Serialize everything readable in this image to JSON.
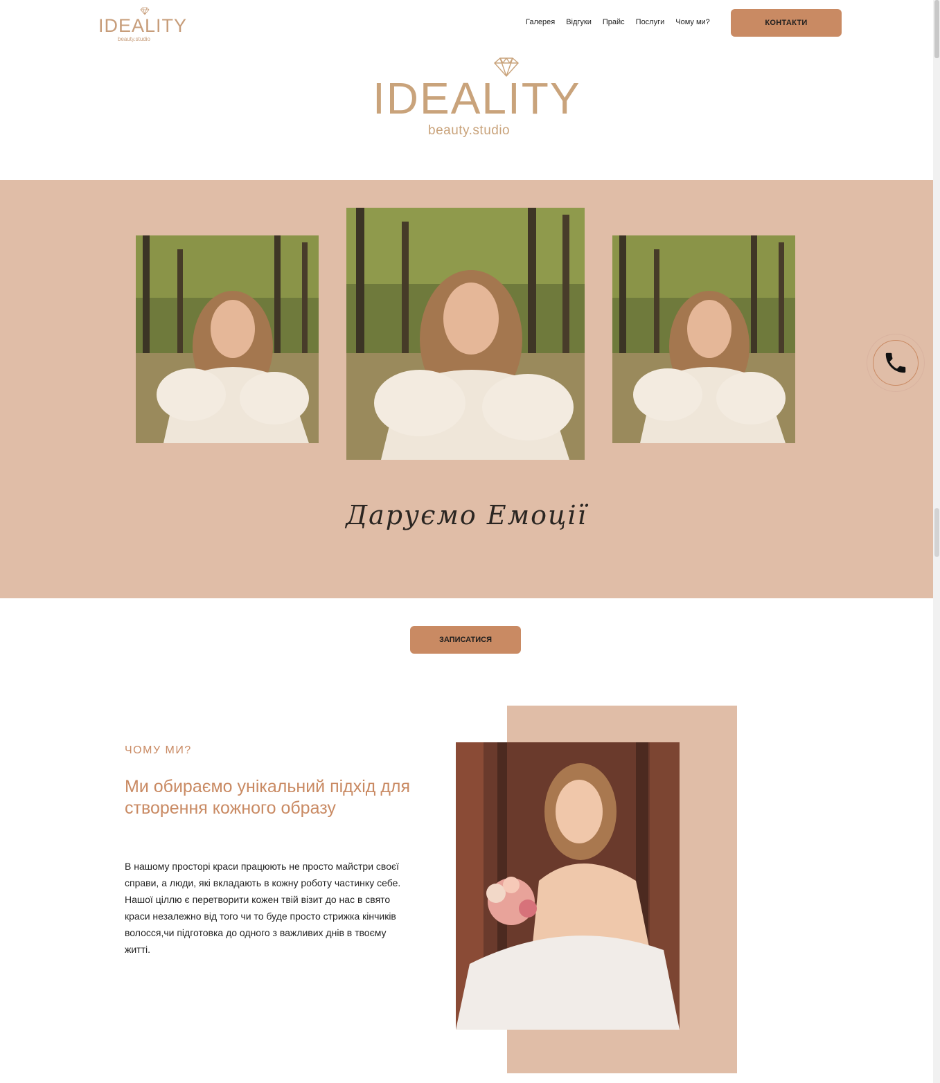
{
  "brand": {
    "name": "IDEALITY",
    "subtitle": "beauty.studio",
    "accent": "#c98a63",
    "band_color": "#e0bda7",
    "logo_gold": "#c9a37b"
  },
  "nav": {
    "items": [
      {
        "label": "Галерея"
      },
      {
        "label": "Відгуки"
      },
      {
        "label": "Прайс"
      },
      {
        "label": "Послуги"
      },
      {
        "label": "Чому ми?"
      }
    ],
    "contacts_label": "КОНТАКТИ"
  },
  "gallery": {
    "tagline": "Даруємо Емоції",
    "icons": [
      "phone-icon"
    ]
  },
  "cta": {
    "book_label": "ЗАПИСАТИСЯ"
  },
  "why": {
    "eyebrow": "ЧОМУ МИ?",
    "title": "Ми обираємо унікальний підхід для створення кожного образу",
    "text": "В нашому просторі краси працюють не просто майстри своєї справи, а люди, які вкладають в кожну роботу частинку себе. Нашої ціллю є перетворити кожен твій візит до нас в свято краси незалежно від того чи то буде просто стрижка кінчиків волосся,чи підготовка до одного з важливих днів в твоєму житті."
  }
}
